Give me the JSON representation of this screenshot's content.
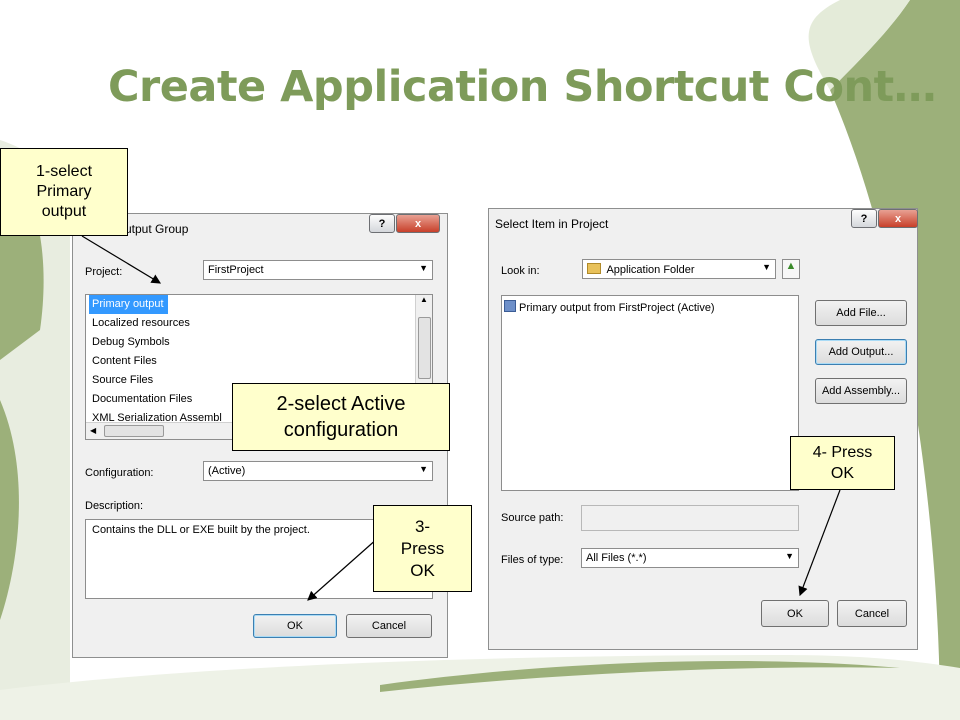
{
  "slide": {
    "title": "Create Application Shortcut Cont…"
  },
  "dialog1": {
    "title": "t Output Group",
    "help": "?",
    "close": "x",
    "project_label": "Project:",
    "project_value": "FirstProject",
    "list": [
      "Primary output",
      "Localized resources",
      "Debug Symbols",
      "Content Files",
      "Source Files",
      "Documentation Files",
      "XML Serialization Assembl"
    ],
    "config_label": "Configuration:",
    "config_value": "(Active)",
    "desc_label": "Description:",
    "desc_text": "Contains the DLL or EXE built by the project.",
    "ok": "OK",
    "cancel": "Cancel"
  },
  "dialog2": {
    "title": "Select Item in Project",
    "help": "?",
    "close": "x",
    "lookin_label": "Look in:",
    "lookin_value": "Application Folder",
    "item": "Primary output from FirstProject (Active)",
    "add_file": "Add File...",
    "add_output": "Add Output...",
    "add_assembly": "Add Assembly...",
    "source_label": "Source path:",
    "filetype_label": "Files of type:",
    "filetype_value": "All Files (*.*)",
    "ok": "OK",
    "cancel": "Cancel"
  },
  "callouts": {
    "c1": [
      "1-select",
      "Primary",
      "output"
    ],
    "c2": [
      "2-select Active",
      "configuration"
    ],
    "c3": [
      "3-",
      "Press",
      "OK"
    ],
    "c4": [
      "4- Press",
      "OK"
    ]
  }
}
